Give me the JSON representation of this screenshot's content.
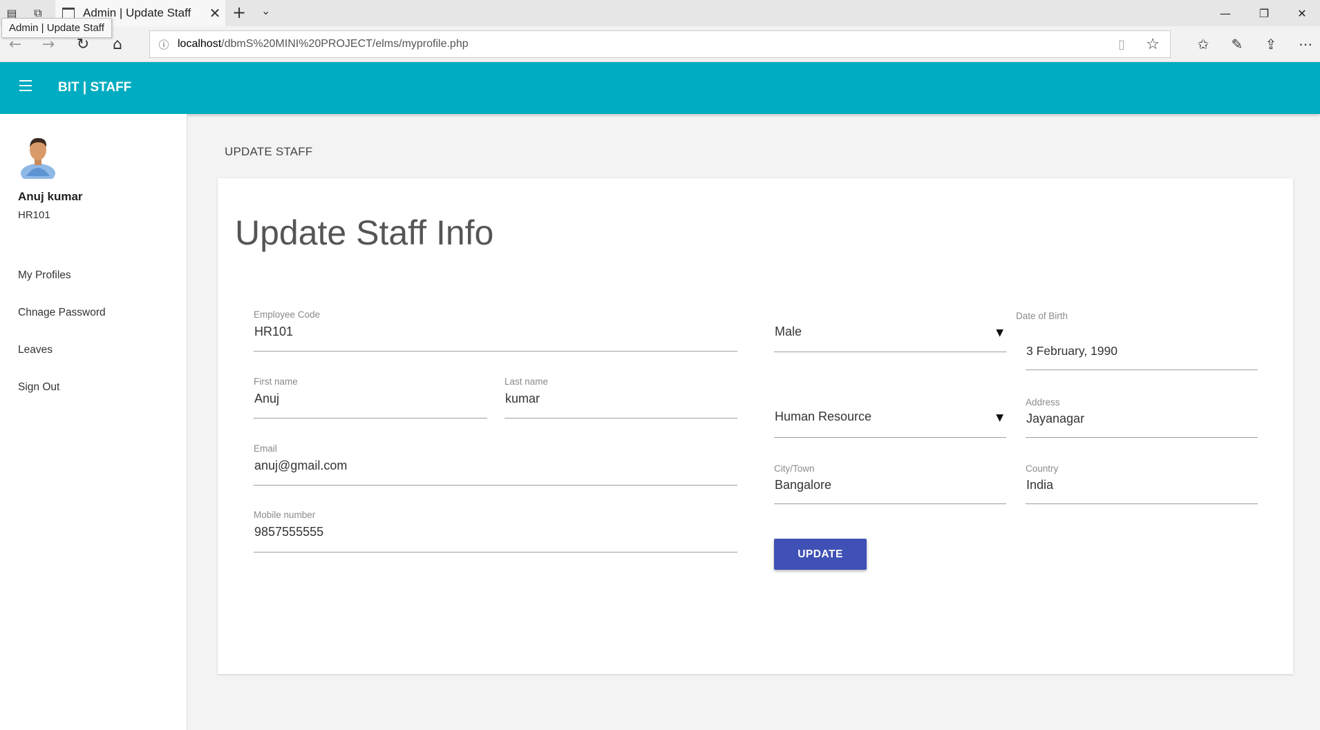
{
  "browser": {
    "tab_title": "Admin | Update Staff",
    "tooltip": "Admin | Update Staff",
    "url_host": "localhost",
    "url_path": "/dbmS%20MINI%20PROJECT/elms/myprofile.php"
  },
  "app": {
    "brand": "BIT | STAFF"
  },
  "sidebar": {
    "user_name": "Anuj kumar",
    "user_code": "HR101",
    "items": [
      {
        "label": "My Profiles"
      },
      {
        "label": "Chnage Password"
      },
      {
        "label": "Leaves"
      },
      {
        "label": "Sign Out"
      }
    ]
  },
  "main": {
    "page_heading": "UPDATE STAFF",
    "card_title": "Update Staff Info",
    "fields": {
      "employee_code": {
        "label": "Employee Code",
        "value": "HR101"
      },
      "first_name": {
        "label": "First name",
        "value": "Anuj"
      },
      "last_name": {
        "label": "Last name",
        "value": "kumar"
      },
      "email": {
        "label": "Email",
        "value": "anuj@gmail.com"
      },
      "mobile": {
        "label": "Mobile number",
        "value": "9857555555"
      },
      "gender": {
        "value": "Male"
      },
      "dob": {
        "label": "Date of Birth",
        "value": "3 February, 1990"
      },
      "department": {
        "value": "Human Resource"
      },
      "address": {
        "label": "Address",
        "value": "Jayanagar"
      },
      "city": {
        "label": "City/Town",
        "value": "Bangalore"
      },
      "country": {
        "label": "Country",
        "value": "India"
      }
    },
    "update_label": "UPDATE"
  },
  "colors": {
    "appbar": "#00acc1",
    "button": "#3f51b5"
  }
}
